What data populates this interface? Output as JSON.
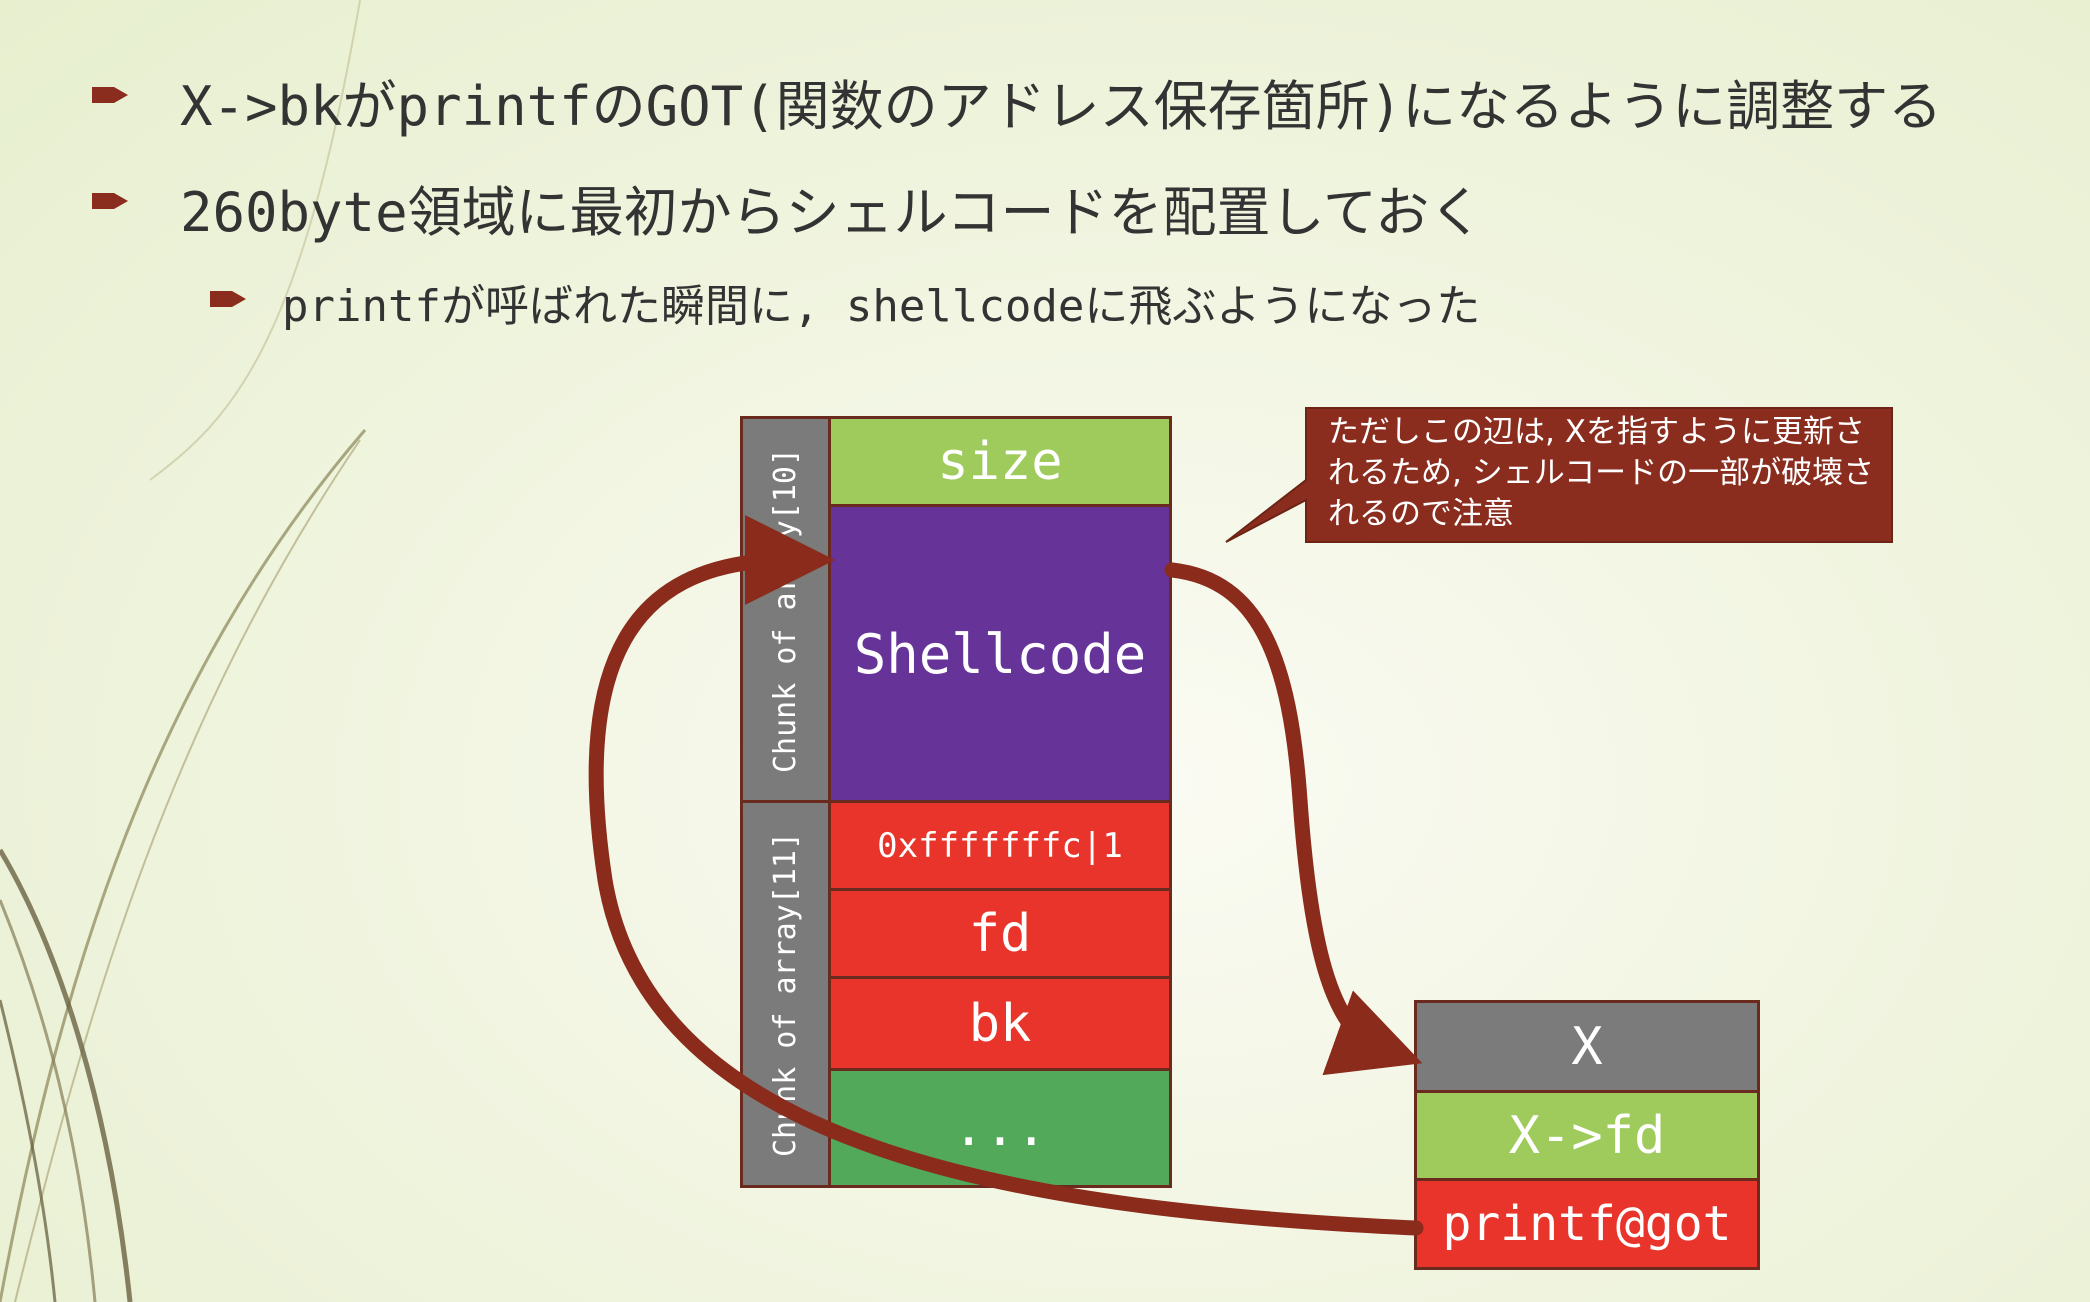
{
  "bullets": [
    "X->bkがprintfのGOT(関数のアドレス保存箇所)になるように調整する",
    "260byte領域に最初からシェルコードを配置しておく",
    "printfが呼ばれた瞬間に, shellcodeに飛ぶようになった"
  ],
  "chunk_labels": {
    "chunk10": "Chunk of array[10]",
    "chunk11": "Chunk of array[11]"
  },
  "memory": {
    "size": "size",
    "shellcode": "Shellcode",
    "header": "0xfffffffc|1",
    "fd": "fd",
    "bk": "bk",
    "rest": "..."
  },
  "target": {
    "x": "X",
    "x_fd": "X->fd",
    "printf_got": "printf@got"
  },
  "callout": "ただしこの辺は, Xを指すように更新されるため, シェルコードの一部が破壊されるので注意",
  "colors": {
    "size": "#9ecb5c",
    "shellcode": "#663399",
    "red": "#e8342a",
    "green": "#52a95a",
    "gray": "#7b7b7b",
    "arrow": "#8a2b1c",
    "callout": "#8a2d1e"
  }
}
